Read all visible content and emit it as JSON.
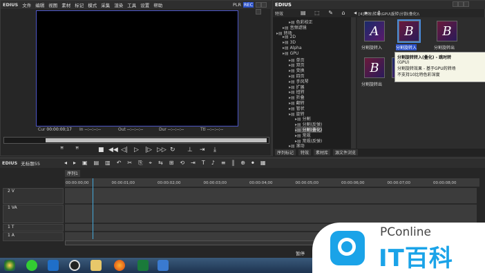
{
  "player": {
    "app_name": "EDIUS",
    "menu": [
      "文件",
      "编辑",
      "视图",
      "素材",
      "标记",
      "模式",
      "采集",
      "渲染",
      "工具",
      "设置",
      "帮助"
    ],
    "plr": "PLR",
    "rec": "REC",
    "cur_label": "Cur",
    "cur_value": "00:00:00;17",
    "in_label": "In",
    "in_value": "--:--:--:--",
    "out_label": "Out",
    "out_value": "--:--:--:--",
    "dur_label": "Dur",
    "dur_value": "--:--:--:--",
    "ttl_label": "Ttl",
    "ttl_value": "--:--:--:--"
  },
  "bin": {
    "app_name": "EDIUS",
    "panel_title": "特效",
    "path": "[4]特效\\转场\\GPU\\旋转\\分割(叠化)\\",
    "tree": [
      {
        "label": "色彩校正",
        "indent": 3
      },
      {
        "label": "音频滤镜",
        "indent": 2
      },
      {
        "label": "转场",
        "indent": 1
      },
      {
        "label": "2D",
        "indent": 2
      },
      {
        "label": "3D",
        "indent": 2
      },
      {
        "label": "Alpha",
        "indent": 2
      },
      {
        "label": "GPU",
        "indent": 2
      },
      {
        "label": "单页",
        "indent": 3
      },
      {
        "label": "双页",
        "indent": 3
      },
      {
        "label": "变换",
        "indent": 3
      },
      {
        "label": "四页",
        "indent": 3
      },
      {
        "label": "手风琴",
        "indent": 3
      },
      {
        "label": "扩展",
        "indent": 3
      },
      {
        "label": "扭转",
        "indent": 3
      },
      {
        "label": "折叠",
        "indent": 3
      },
      {
        "label": "翻转",
        "indent": 3
      },
      {
        "label": "管状",
        "indent": 3
      },
      {
        "label": "旋转",
        "indent": 3
      },
      {
        "label": "分割",
        "indent": 4
      },
      {
        "label": "分割(反弹)",
        "indent": 4
      },
      {
        "label": "分割(叠化)",
        "indent": 4,
        "selected": true
      },
      {
        "label": "常规",
        "indent": 4
      },
      {
        "label": "常规(反弹)",
        "indent": 4
      },
      {
        "label": "滚动",
        "indent": 3
      }
    ],
    "thumbs": [
      {
        "letter": "A",
        "label": "分割旋转入"
      },
      {
        "letter": "B",
        "label": "分割旋转入"
      },
      {
        "letter": "B",
        "label": "分割旋转出"
      },
      {
        "letter": "B",
        "label": "分割旋转出"
      },
      {
        "letter": "A",
        "label": ""
      }
    ],
    "tooltip": {
      "title": "分割旋转转入(叠化) - 跳时转",
      "line1": "(GPU)",
      "line2": "分割旋转效果 - 基于GPU的转场",
      "line3": "不支持10比特色彩深度"
    },
    "tabs": [
      "序列标记",
      "特效",
      "素材库",
      "源文件浏览"
    ]
  },
  "timeline": {
    "app_name": "EDIUS",
    "project": "无标题55",
    "seq_tab": "序列1",
    "ticks": [
      "00:00:00;00",
      "00:00:01;00",
      "00:00:02;00",
      "00:00:03;00",
      "00:00:04;00",
      "00:00:05;00",
      "00:00:06;00",
      "00:00:07;00",
      "00:00:08;00"
    ],
    "tracks": [
      {
        "name": "2 V",
        "h": 24
      },
      {
        "name": "1 VA",
        "h": 28
      },
      {
        "name": "1 T",
        "h": 12
      },
      {
        "name": "1 A",
        "h": 14
      }
    ],
    "status_text": "暂停"
  },
  "watermark": {
    "brand_small": "PConline",
    "brand_big": "IT百科"
  }
}
